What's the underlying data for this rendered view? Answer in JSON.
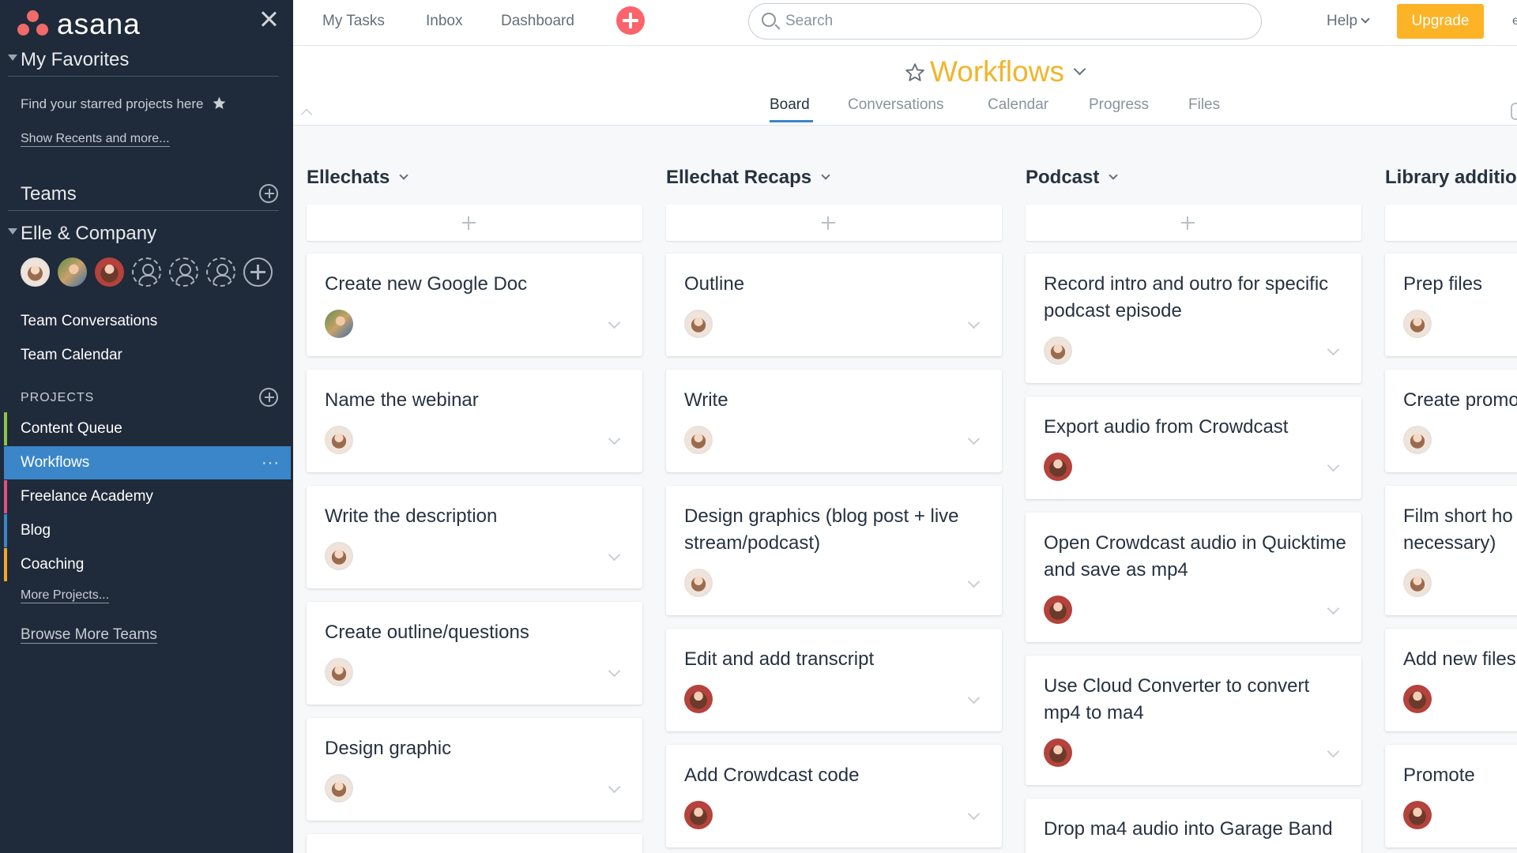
{
  "sidebar": {
    "brand": "asana",
    "favorites": {
      "heading": "My Favorites",
      "hint": "Find your starred projects here",
      "recents_link": "Show Recents and more..."
    },
    "teams": {
      "heading": "Teams"
    },
    "team": {
      "name": "Elle & Company"
    },
    "team_links": [
      "Team Conversations",
      "Team Calendar"
    ],
    "projects": {
      "heading": "PROJECTS",
      "items": [
        {
          "label": "Content Queue",
          "color": "#8fc44a"
        },
        {
          "label": "Workflows",
          "color": "#3a86c8",
          "active": true
        },
        {
          "label": "Freelance Academy",
          "color": "#e34f80"
        },
        {
          "label": "Blog",
          "color": "#3a86c8"
        },
        {
          "label": "Coaching",
          "color": "#f5a623"
        }
      ],
      "more_link": "More Projects..."
    },
    "browse_link": "Browse More Teams"
  },
  "topbar": {
    "nav": [
      "My Tasks",
      "Inbox",
      "Dashboard"
    ],
    "search_placeholder": "Search",
    "help": "Help",
    "upgrade": "Upgrade"
  },
  "project": {
    "title": "Workflows",
    "title_color": "#f1b52b",
    "tabs": [
      {
        "label": "Board",
        "active": true
      },
      {
        "label": "Conversations"
      },
      {
        "label": "Calendar"
      },
      {
        "label": "Progress"
      },
      {
        "label": "Files"
      }
    ]
  },
  "board": {
    "columns": [
      {
        "title": "Ellechats",
        "cards": [
          {
            "title": "Create new Google Doc",
            "assignee": "b"
          },
          {
            "title": "Name the webinar",
            "assignee": "a"
          },
          {
            "title": "Write the description",
            "assignee": "a"
          },
          {
            "title": "Create outline/questions",
            "assignee": "a"
          },
          {
            "title": "Design graphic",
            "assignee": "a"
          },
          {
            "title": "",
            "assignee": ""
          }
        ]
      },
      {
        "title": "Ellechat Recaps",
        "cards": [
          {
            "title": "Outline",
            "assignee": "a"
          },
          {
            "title": "Write",
            "assignee": "a"
          },
          {
            "title": "Design graphics (blog post + live stream/podcast)",
            "assignee": "a"
          },
          {
            "title": "Edit and add transcript",
            "assignee": "c"
          },
          {
            "title": "Add Crowdcast code",
            "assignee": "c"
          }
        ]
      },
      {
        "title": "Podcast",
        "cards": [
          {
            "title": "Record intro and outro for specific podcast episode",
            "assignee": "a"
          },
          {
            "title": "Export audio from Crowdcast",
            "assignee": "c"
          },
          {
            "title": "Open Crowdcast audio in Quicktime and save as mp4",
            "assignee": "c"
          },
          {
            "title": "Use Cloud Converter to convert mp4 to ma4",
            "assignee": "c"
          },
          {
            "title": "Drop ma4 audio into Garage Band",
            "assignee": ""
          }
        ]
      },
      {
        "title": "Library additio",
        "cards": [
          {
            "title": "Prep files",
            "assignee": "a"
          },
          {
            "title": "Create promo",
            "assignee": "a"
          },
          {
            "title": "Film short ho necessary)",
            "assignee": "a"
          },
          {
            "title": "Add new files",
            "assignee": "c"
          },
          {
            "title": "Promote",
            "assignee": "c"
          }
        ]
      }
    ]
  }
}
